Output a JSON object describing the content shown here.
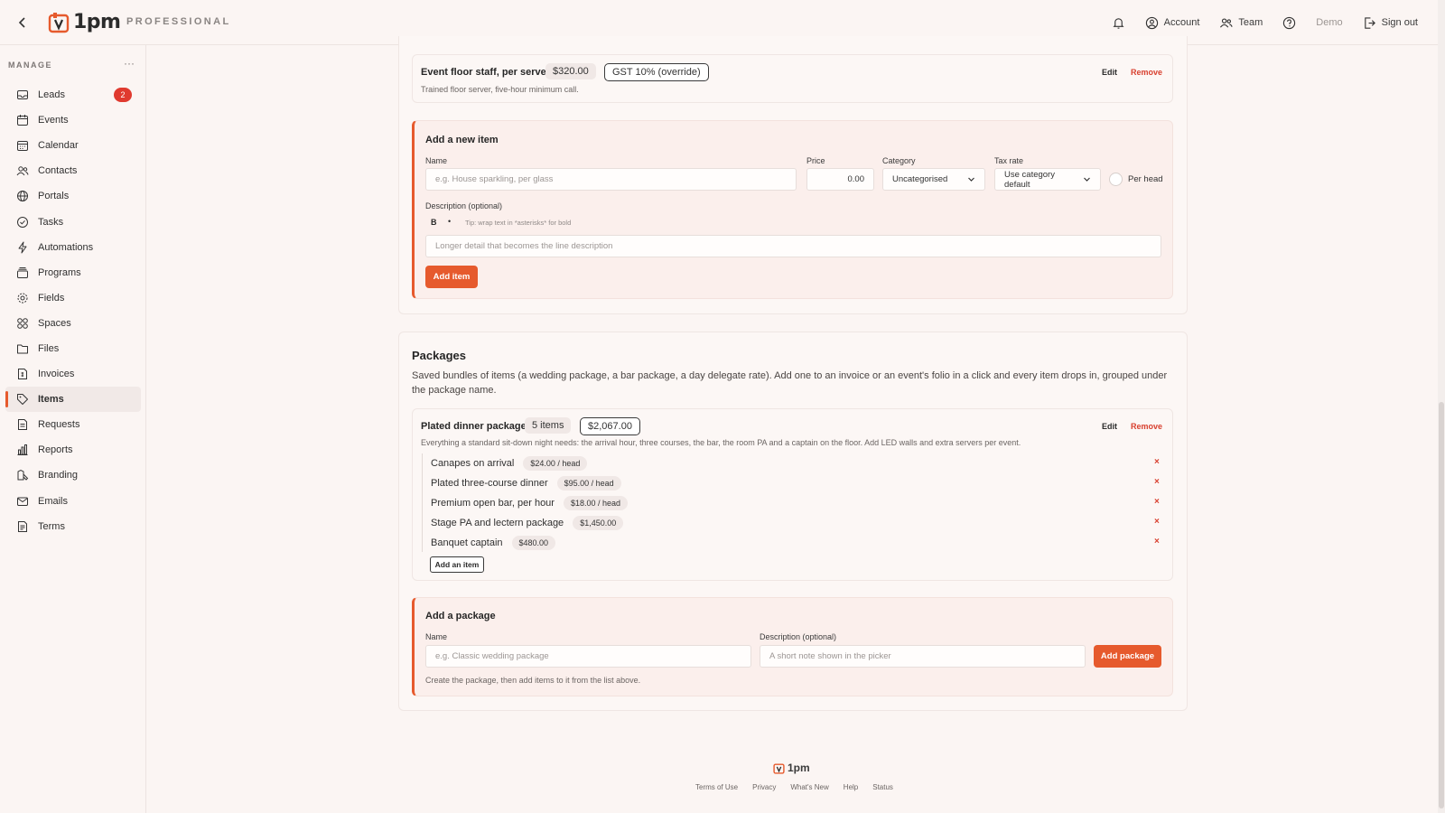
{
  "app": {
    "name": "1pm",
    "plan": "PROFESSIONAL"
  },
  "topbar": {
    "account": "Account",
    "team": "Team",
    "demo": "Demo",
    "signout": "Sign out"
  },
  "sidebar": {
    "section": "MANAGE",
    "more": "···",
    "items": [
      {
        "label": "Leads",
        "badge": "2"
      },
      {
        "label": "Events"
      },
      {
        "label": "Calendar"
      },
      {
        "label": "Contacts"
      },
      {
        "label": "Portals"
      },
      {
        "label": "Tasks"
      },
      {
        "label": "Automations"
      },
      {
        "label": "Programs"
      },
      {
        "label": "Fields"
      },
      {
        "label": "Spaces"
      },
      {
        "label": "Files"
      },
      {
        "label": "Invoices"
      },
      {
        "label": "Items"
      },
      {
        "label": "Requests"
      },
      {
        "label": "Reports"
      },
      {
        "label": "Branding"
      },
      {
        "label": "Emails"
      },
      {
        "label": "Terms"
      }
    ],
    "active": "Items"
  },
  "item_row": {
    "name": "Event floor staff, per server",
    "price": "$320.00",
    "tax": "GST 10% (override)",
    "description": "Trained floor server, five-hour minimum call.",
    "edit": "Edit",
    "remove": "Remove"
  },
  "new_item": {
    "title": "Add a new item",
    "name_label": "Name",
    "name_placeholder": "e.g. House sparkling, per glass",
    "price_label": "Price",
    "price_value": "0.00",
    "category_label": "Category",
    "category_value": "Uncategorised",
    "tax_label": "Tax rate",
    "tax_value": "Use category default",
    "per_head": "Per head",
    "desc_label": "Description (optional)",
    "bold": "B",
    "bullet": "•",
    "tip": "Tip: wrap text in *asterisks* for bold",
    "desc_placeholder": "Longer detail that becomes the line description",
    "button": "Add item"
  },
  "packages": {
    "title": "Packages",
    "intro": "Saved bundles of items (a wedding package, a bar package, a day delegate rate). Add one to an invoice or an event's folio in a click and every item drops in, grouped under the package name.",
    "package": {
      "name": "Plated dinner package",
      "count": "5 items",
      "total": "$2,067.00",
      "edit": "Edit",
      "remove": "Remove",
      "description": "Everything a standard sit-down night needs: the arrival hour, three courses, the bar, the room PA and a captain on the floor. Add LED walls and extra servers per event.",
      "items": [
        {
          "name": "Canapes on arrival",
          "price": "$24.00 / head"
        },
        {
          "name": "Plated three-course dinner",
          "price": "$95.00 / head"
        },
        {
          "name": "Premium open bar, per hour",
          "price": "$18.00 / head"
        },
        {
          "name": "Stage PA and lectern package",
          "price": "$1,450.00"
        },
        {
          "name": "Banquet captain",
          "price": "$480.00"
        }
      ],
      "add_item": "Add an item",
      "remove_mark": "×"
    },
    "add": {
      "title": "Add a package",
      "name_label": "Name",
      "name_placeholder": "e.g. Classic wedding package",
      "desc_label": "Description (optional)",
      "desc_placeholder": "A short note shown in the picker",
      "button": "Add package",
      "hint": "Create the package, then add items to it from the list above."
    }
  },
  "footer": {
    "logo": "1pm",
    "links": [
      "Terms of Use",
      "Privacy",
      "What's New",
      "Help",
      "Status"
    ]
  },
  "colors": {
    "accent": "#e65a2d",
    "danger": "#d8402f",
    "background": "#fbf5f3"
  }
}
